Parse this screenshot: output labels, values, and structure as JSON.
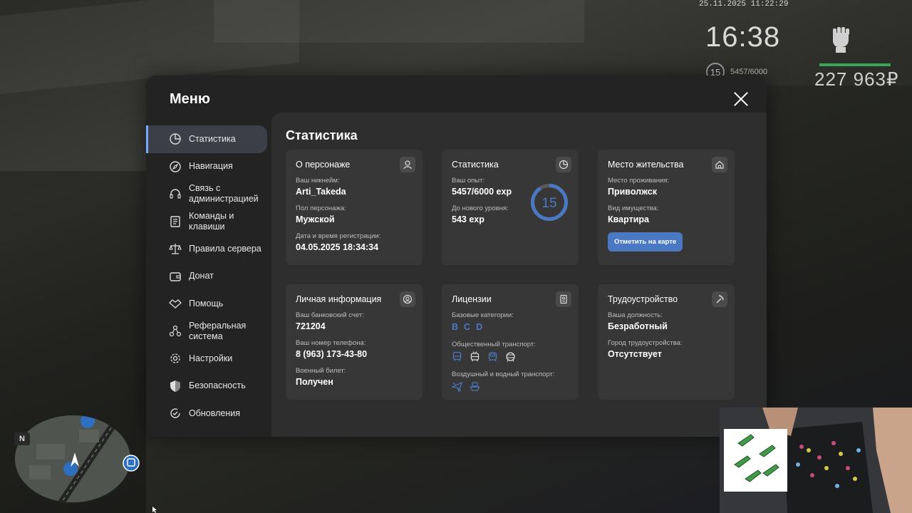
{
  "hud": {
    "datetime": "25.11.2025 11:22:29",
    "clock": "16:38",
    "level": "15",
    "exp": "5457/6000",
    "money": "227 963₽",
    "health_fraction": 0.98
  },
  "menu": {
    "title": "Меню",
    "sidebar": [
      {
        "label": "Статистика",
        "icon": "pie-chart-icon",
        "active": true
      },
      {
        "label": "Навигация",
        "icon": "compass-icon"
      },
      {
        "label": "Связь с администрацией",
        "icon": "headset-icon"
      },
      {
        "label": "Команды и клавиши",
        "icon": "document-icon"
      },
      {
        "label": "Правила сервера",
        "icon": "scales-icon"
      },
      {
        "label": "Донат",
        "icon": "wallet-icon"
      },
      {
        "label": "Помощь",
        "icon": "handshake-icon"
      },
      {
        "label": "Реферальная система",
        "icon": "network-icon"
      },
      {
        "label": "Настройки",
        "icon": "gear-icon"
      },
      {
        "label": "Безопасность",
        "icon": "shield-icon"
      },
      {
        "label": "Обновления",
        "icon": "refresh-check-icon"
      }
    ],
    "content_title": "Статистика",
    "cards": {
      "character": {
        "title": "О персонаже",
        "nickname_label": "Ваш никнейм:",
        "nickname": "Arti_Takeda",
        "gender_label": "Пол персонажа:",
        "gender": "Мужской",
        "reg_label": "Дата и время регистрации:",
        "reg_date": "04.05.2025 18:34:34"
      },
      "stats": {
        "title": "Статистика",
        "exp_label": "Ваш опыт:",
        "exp": "5457/6000 exp",
        "next_label": "До нового уровня:",
        "next": "543 exp",
        "level": "15",
        "progress": 0.9095
      },
      "residence": {
        "title": "Место жительства",
        "place_label": "Место проживания:",
        "place": "Приволжск",
        "property_label": "Вид имущества:",
        "property": "Квартира",
        "button": "Отметить на карте"
      },
      "personal": {
        "title": "Личная информация",
        "bank_label": "Ваш банковский счет:",
        "bank": "721204",
        "phone_label": "Ваш номер телефона:",
        "phone": "8 (963) 173-43-80",
        "military_label": "Военный билет:",
        "military": "Получен"
      },
      "licenses": {
        "title": "Лицензии",
        "base_label": "Базовые категории:",
        "categories": [
          "B",
          "C",
          "D"
        ],
        "public_label": "Общественный транспорт:",
        "public_icons": [
          "bus-icon",
          "trolleybus-icon",
          "tram-icon",
          "metro-icon"
        ],
        "air_label": "Воздушный и водный транспорт:",
        "air_icons": [
          "plane-icon",
          "boat-icon"
        ]
      },
      "job": {
        "title": "Трудоустройство",
        "position_label": "Ваша должность:",
        "position": "Безработный",
        "city_label": "Город трудоустройства:",
        "city": "Отсутствует"
      }
    }
  },
  "minimap": {
    "north_label": "N"
  },
  "colors": {
    "accent": "#4b78c3",
    "active_bar": "#7aa7ff",
    "health": "#3aa655"
  }
}
